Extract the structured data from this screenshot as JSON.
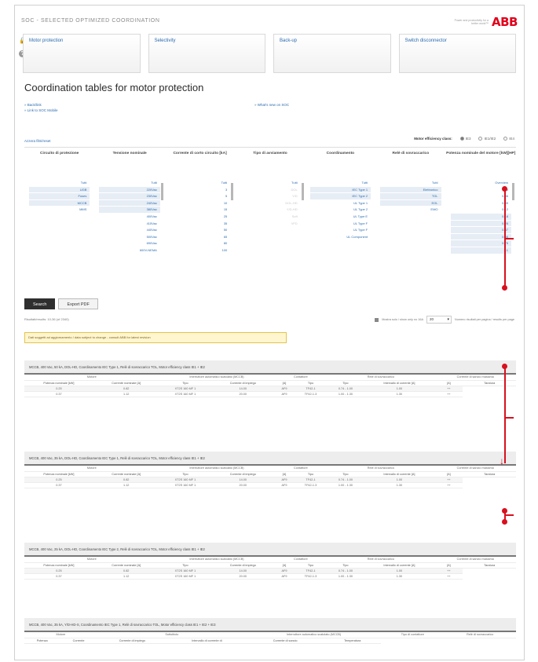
{
  "app": {
    "title": "SOC - SELECTED OPTIMIZED COORDINATION",
    "logo_tagline": "Power and productivity for a better world™",
    "logo": "ABB",
    "help_icon": "question-icon",
    "lock_icon": "lock-icon"
  },
  "tabs": [
    "Motor protection",
    "Selectivity",
    "Back-up",
    "Switch disconnector"
  ],
  "page": {
    "heading": "Coordination tables for motor protection",
    "link_1": "» Back/link",
    "link_2": "» Link to SOC Mobile",
    "whats_new": "» What's new on SOC",
    "reset": "Azzera filtri/reset",
    "efficiency_label": "Motor efficiency class:",
    "efficiency_options": [
      {
        "label": "IE3",
        "selected": true
      },
      {
        "label": "IE1/IE2",
        "selected": false
      },
      {
        "label": "IE4",
        "selected": false
      }
    ]
  },
  "filters": {
    "headers": [
      "Circuito di protezione",
      "Tensione nominale",
      "Corrente di corto circuito [kA]",
      "Tipo di avviamento",
      "Coordinamento",
      "Relè di sovraccarico",
      "Potenza nominale del motore [kW][HP]"
    ],
    "columns": [
      [
        "Tutti",
        "UGB",
        "Fuses",
        "MCCB",
        "MMS"
      ],
      [
        "Tutti",
        "220Vac",
        "230Vac",
        "240Vac",
        "380Vac",
        "400Vac",
        "415Vac",
        "440Vac",
        "500Vac",
        "690Vac",
        "600V-NEMA"
      ],
      [
        "Tutti",
        "3",
        "5",
        "10",
        "15",
        "25",
        "35",
        "50",
        "65",
        "80",
        "100"
      ],
      [
        "Tutti",
        "DOL",
        "Y/D",
        "DOL-HD",
        "Y/D-HD",
        "Soft",
        "VFD"
      ],
      [
        "Tutti",
        "IEC Type 1",
        "IEC Type 2",
        "UL Type 1",
        "UL Type 2",
        "UL Type E",
        "UL Type F",
        "UL Type F",
        "UL Component"
      ],
      [
        "Tutti",
        "Elettronico",
        "TOL",
        "EOL",
        "EMO"
      ],
      [
        "Overview",
        "0",
        "0.06",
        "0.09",
        "0.12",
        "0.18",
        "0.25",
        "0.37",
        "0.55",
        "0.75",
        "1.1"
      ]
    ]
  },
  "buttons": {
    "search": "Search",
    "export": "Export PDF"
  },
  "results": {
    "count": "Risultati/results: 10-36 (of 2340)",
    "option_label": "Mostra solo / show only no 16A",
    "per_page_label": "Numero risultati per pagina / results per page",
    "per_page_value": "20",
    "warning": "Dati soggetti ad aggiornamento / data subject to change - consult ABB for latest revision"
  },
  "blocks": [
    {
      "title": "MCCB, 400 Vac, 50 kA, DOL-HD, Coordinamento IEC Type 1, Relè di sovraccarico TOL, Motor efficiency class IE1 + IE2",
      "groups": [
        "Motore",
        "Interruttore automatico scatolato (MCCB)",
        "Contattore",
        "Relè di sovraccarico",
        "Corrente di sancio massima"
      ],
      "headers": [
        "Potenza nominale [kW]",
        "Corrente nominale [A]",
        "Tipo",
        "Corrente di impiego",
        "[A]",
        "Tipo",
        "Tipo",
        "Intervallo di corrente [A]",
        "[A]",
        "Taratura"
      ],
      "rows": [
        [
          "0.25",
          "0.82",
          "XT2S 160 MF 1",
          "14.00",
          "AF9",
          "TF42-1",
          "0.74 - 1.00",
          "1.00",
          "++"
        ],
        [
          "0.37",
          "1.12",
          "XT2S 160 MF 1",
          "20.00",
          "AF9",
          "TF42-1.3",
          "1.00 - 1.30",
          "1.30",
          "++"
        ]
      ]
    },
    {
      "title": "MCCB, 400 Vac, 35 kA, DOL-HD, Coordinamento IEC Type 1, Relè di sovraccarico TOL, Motor efficiency class IE1 + IE2",
      "groups": [
        "Motore",
        "Interruttore automatico scatolato (MCCB)",
        "Contattore",
        "Relè di sovraccarico",
        "Corrente di sancio massima"
      ],
      "headers": [
        "Potenza nominale [kW]",
        "Corrente nominale [A]",
        "Tipo",
        "Corrente di impiego",
        "[A]",
        "Tipo",
        "Tipo",
        "Intervallo di corrente [A]",
        "[A]",
        "Taratura"
      ],
      "rows": [
        [
          "0.25",
          "0.82",
          "XT2S 160 MF 1",
          "14.00",
          "AF9",
          "TF42-1",
          "0.74 - 1.00",
          "1.00",
          "++"
        ],
        [
          "0.37",
          "1.12",
          "XT2S 160 MF 1",
          "20.00",
          "AF9",
          "TF42-1.3",
          "1.00 - 1.30",
          "1.30",
          "++"
        ]
      ]
    },
    {
      "title": "MCCB, 400 Vac, 25 kA, DOL-HD, Coordinamento IEC Type 2, Relè di sovraccarico TOL, Motor efficiency class IE1 + IE2",
      "groups": [
        "Motore",
        "Interruttore automatico scatolato (MCCB)",
        "Contattore",
        "Relè di sovraccarico",
        "Corrente di sancio massima"
      ],
      "headers": [
        "Potenza nominale [kW]",
        "Corrente nominale [A]",
        "Tipo",
        "Corrente di impiego",
        "[A]",
        "Tipo",
        "Tipo",
        "Intervallo di corrente [A]",
        "[A]",
        "Taratura"
      ],
      "rows": [
        [
          "0.25",
          "0.82",
          "XT2S 160 MF 1",
          "14.00",
          "AF9",
          "TF42-1",
          "0.74 - 1.00",
          "1.00",
          "++"
        ],
        [
          "0.37",
          "1.12",
          "XT2S 160 MF 1",
          "20.00",
          "AF9",
          "TF42-1.3",
          "1.00 - 1.30",
          "1.30",
          "++"
        ]
      ]
    },
    {
      "title": "MCCB, 400 Vac, 35 kA, Y/D-HD-S, Coordinamento IEC Type 1, Relè di sovraccarico TOL, Motor efficiency class IE1 + IE2 + IE3",
      "groups": [
        "Motore",
        "Sottotitolo",
        "Interruttore automatico scatolato (MCCB)",
        "Tipo di contattore",
        "Relè di sovraccarico"
      ],
      "headers": [
        "Potenza",
        "Corrente",
        "Corrente di impiego",
        "Intervallo di corrente di",
        "Corrente di sancio",
        "Temperatura"
      ],
      "rows": []
    }
  ],
  "colors": {
    "accent": "#2a6bb0",
    "brand": "#e2001a",
    "annotation": "#d8101e",
    "warning_bg": "#fff6cf"
  }
}
